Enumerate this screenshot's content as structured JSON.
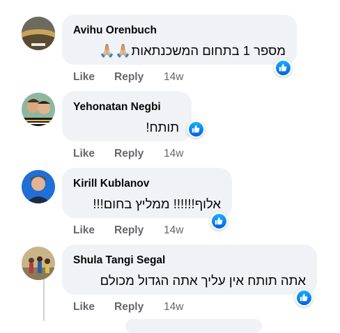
{
  "comments": [
    {
      "author": "Avihu Orenbuch",
      "text": "מספר 1 בתחום המשכנתאות🙏🏼🙏🏼",
      "actions": {
        "like": "Like",
        "reply": "Reply",
        "time": "14w"
      }
    },
    {
      "author": "Yehonatan Negbi",
      "text": "תותח!",
      "actions": {
        "like": "Like",
        "reply": "Reply",
        "time": "14w"
      }
    },
    {
      "author": "Kirill Kublanov",
      "text": "אלוף!!!!!! ממליץ בחום!!!",
      "actions": {
        "like": "Like",
        "reply": "Reply",
        "time": "14w"
      }
    },
    {
      "author": "Shula Tangi Segal",
      "text": "אתה תותח אין עליך אתה הגדול מכולם",
      "actions": {
        "like": "Like",
        "reply": "Reply",
        "time": "14w"
      }
    }
  ],
  "icons": {
    "reaction": "like-thumb-icon"
  },
  "colors": {
    "bubble": "#f0f2f5",
    "meta_text": "#65676b",
    "like_blue": "#1877f2"
  }
}
